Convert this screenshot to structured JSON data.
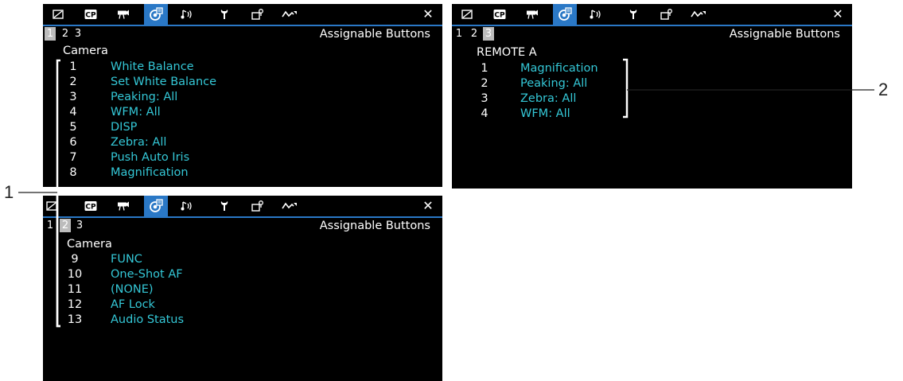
{
  "tabs": [
    {
      "icon": "picture-icon",
      "glyph": "◿"
    },
    {
      "icon": "cp-icon",
      "glyph": "CP"
    },
    {
      "icon": "camera-icon",
      "glyph": "▀"
    },
    {
      "icon": "assign-icon",
      "glyph": "☰"
    },
    {
      "icon": "audio-icon",
      "glyph": "♪"
    },
    {
      "icon": "wrench-icon",
      "glyph": "Y"
    },
    {
      "icon": "recording-icon",
      "glyph": "▢"
    },
    {
      "icon": "waveform-icon",
      "glyph": "∿"
    }
  ],
  "close_glyph": "✕",
  "colors": {
    "accent": "#2a78c6",
    "value": "#34c7d6",
    "page_highlight": "#bcbcbc"
  },
  "screens": [
    {
      "title": "Assignable Buttons",
      "pages": [
        "1",
        "2",
        "3"
      ],
      "selected_page": 0,
      "group": "Camera",
      "rows": [
        {
          "num": "1",
          "value": "White Balance"
        },
        {
          "num": "2",
          "value": "Set White Balance"
        },
        {
          "num": "3",
          "value": "Peaking: All"
        },
        {
          "num": "4",
          "value": "WFM: All"
        },
        {
          "num": "5",
          "value": "DISP"
        },
        {
          "num": "6",
          "value": "Zebra: All"
        },
        {
          "num": "7",
          "value": "Push Auto Iris"
        },
        {
          "num": "8",
          "value": "Magnification"
        }
      ]
    },
    {
      "title": "Assignable Buttons",
      "pages": [
        "1",
        "2",
        "3"
      ],
      "selected_page": 2,
      "group": "REMOTE A",
      "rows": [
        {
          "num": "1",
          "value": "Magnification"
        },
        {
          "num": "2",
          "value": "Peaking: All"
        },
        {
          "num": "3",
          "value": "Zebra: All"
        },
        {
          "num": "4",
          "value": "WFM: All"
        }
      ]
    },
    {
      "title": "Assignable Buttons",
      "pages": [
        "1",
        "2",
        "3"
      ],
      "selected_page": 1,
      "group": "Camera",
      "rows": [
        {
          "num": "9",
          "value": "FUNC"
        },
        {
          "num": "10",
          "value": "One-Shot AF"
        },
        {
          "num": "11",
          "value": "(NONE)"
        },
        {
          "num": "12",
          "value": "AF Lock"
        },
        {
          "num": "13",
          "value": "Audio Status"
        }
      ]
    }
  ],
  "callouts": {
    "one": "1",
    "two": "2"
  }
}
